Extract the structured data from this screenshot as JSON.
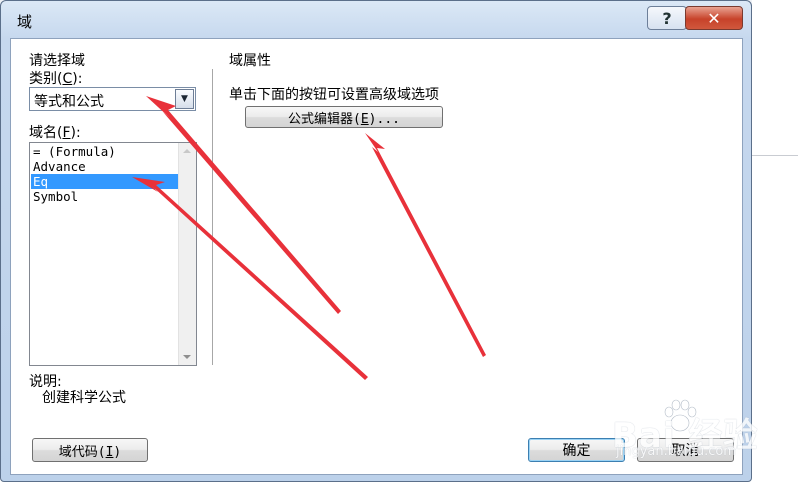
{
  "window": {
    "title": "域",
    "help_label": "?",
    "close_label": "✕"
  },
  "left_panel": {
    "group_title": "请选择域",
    "category_label": "类别",
    "category_hotkey": "C",
    "category_value": "等式和公式",
    "field_name_label": "域名",
    "field_name_hotkey": "F",
    "field_names": [
      "= (Formula)",
      "Advance",
      "Eq",
      "Symbol"
    ],
    "selected_field": "Eq",
    "description_label": "说明:",
    "description_text": "创建科学公式"
  },
  "right_panel": {
    "group_title": "域属性",
    "hint": "单击下面的按钮可设置高级域选项",
    "equation_editor_button": "公式编辑器",
    "equation_editor_hotkey": "E"
  },
  "buttons": {
    "field_codes": "域代码",
    "field_codes_hotkey": "I",
    "ok": "确定",
    "cancel": "取消"
  },
  "watermark": {
    "brand": "Bai 经验",
    "url": "jingyan.baidu.com"
  },
  "colors": {
    "selection": "#3399ff",
    "annotation_arrow": "#e8313a",
    "close_button": "#c7422a"
  }
}
